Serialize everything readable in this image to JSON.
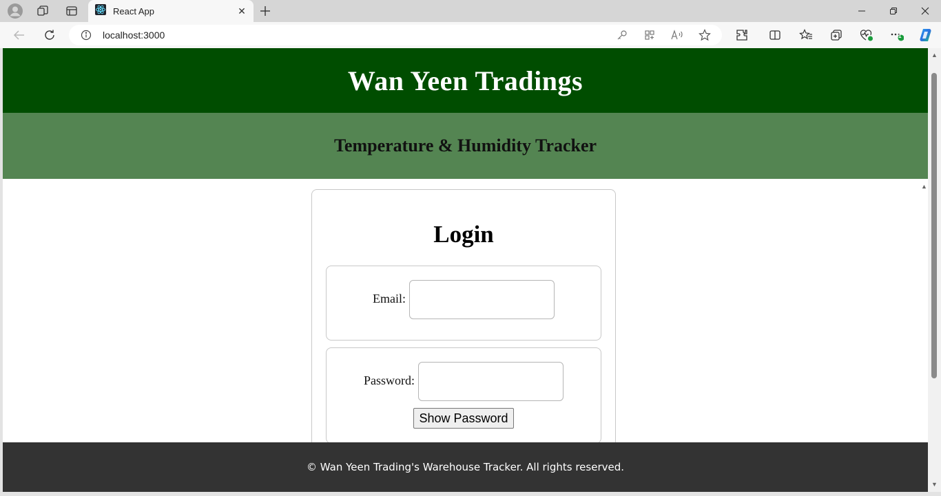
{
  "browser": {
    "tab_title": "React App",
    "address": "localhost:3000",
    "favorites_badge": "1"
  },
  "page": {
    "company_name": "Wan Yeen Tradings",
    "subtitle": "Temperature & Humidity Tracker",
    "login": {
      "title": "Login",
      "email_label": "Email:",
      "email_value": "",
      "password_label": "Password:",
      "password_value": "",
      "show_password_label": "Show Password"
    },
    "footer_text": "© Wan Yeen Trading's Warehouse Tracker. All rights reserved."
  },
  "colors": {
    "header_bg": "#004d00",
    "subheader_bg": "#548552",
    "footer_bg": "#333333"
  },
  "icons": [
    "profile-icon",
    "workspaces-icon",
    "tab-actions-icon",
    "react-favicon",
    "close-icon",
    "new-tab-icon",
    "minimize-icon",
    "restore-icon",
    "window-close-icon",
    "back-icon",
    "refresh-icon",
    "info-icon",
    "key-icon",
    "app-available-icon",
    "read-aloud-icon",
    "favorite-star-icon",
    "extensions-icon",
    "split-screen-icon",
    "favorites-icon",
    "collections-icon",
    "browser-essentials-icon",
    "more-icon",
    "copilot-icon"
  ]
}
